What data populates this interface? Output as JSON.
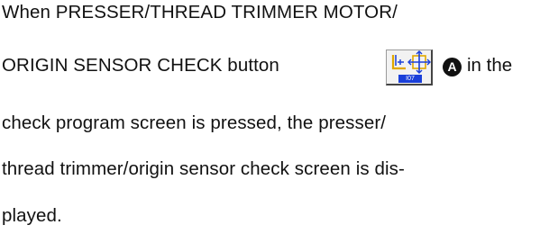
{
  "paragraph": {
    "line1": "When PRESSER/THREAD TRIMMER MOTOR/",
    "line2_before": "ORIGIN SENSOR CHECK button",
    "line2_after": "in the",
    "line3": "check program screen is pressed, the presser/",
    "line4": "thread trimmer/origin sensor check screen is dis-",
    "line5": "played."
  },
  "button_icon": {
    "icon": "presser-thread-trimmer-origin-sensor-icon",
    "code_label": "I07",
    "code_color": "#1a3fd9"
  },
  "callout": {
    "letter": "A"
  }
}
